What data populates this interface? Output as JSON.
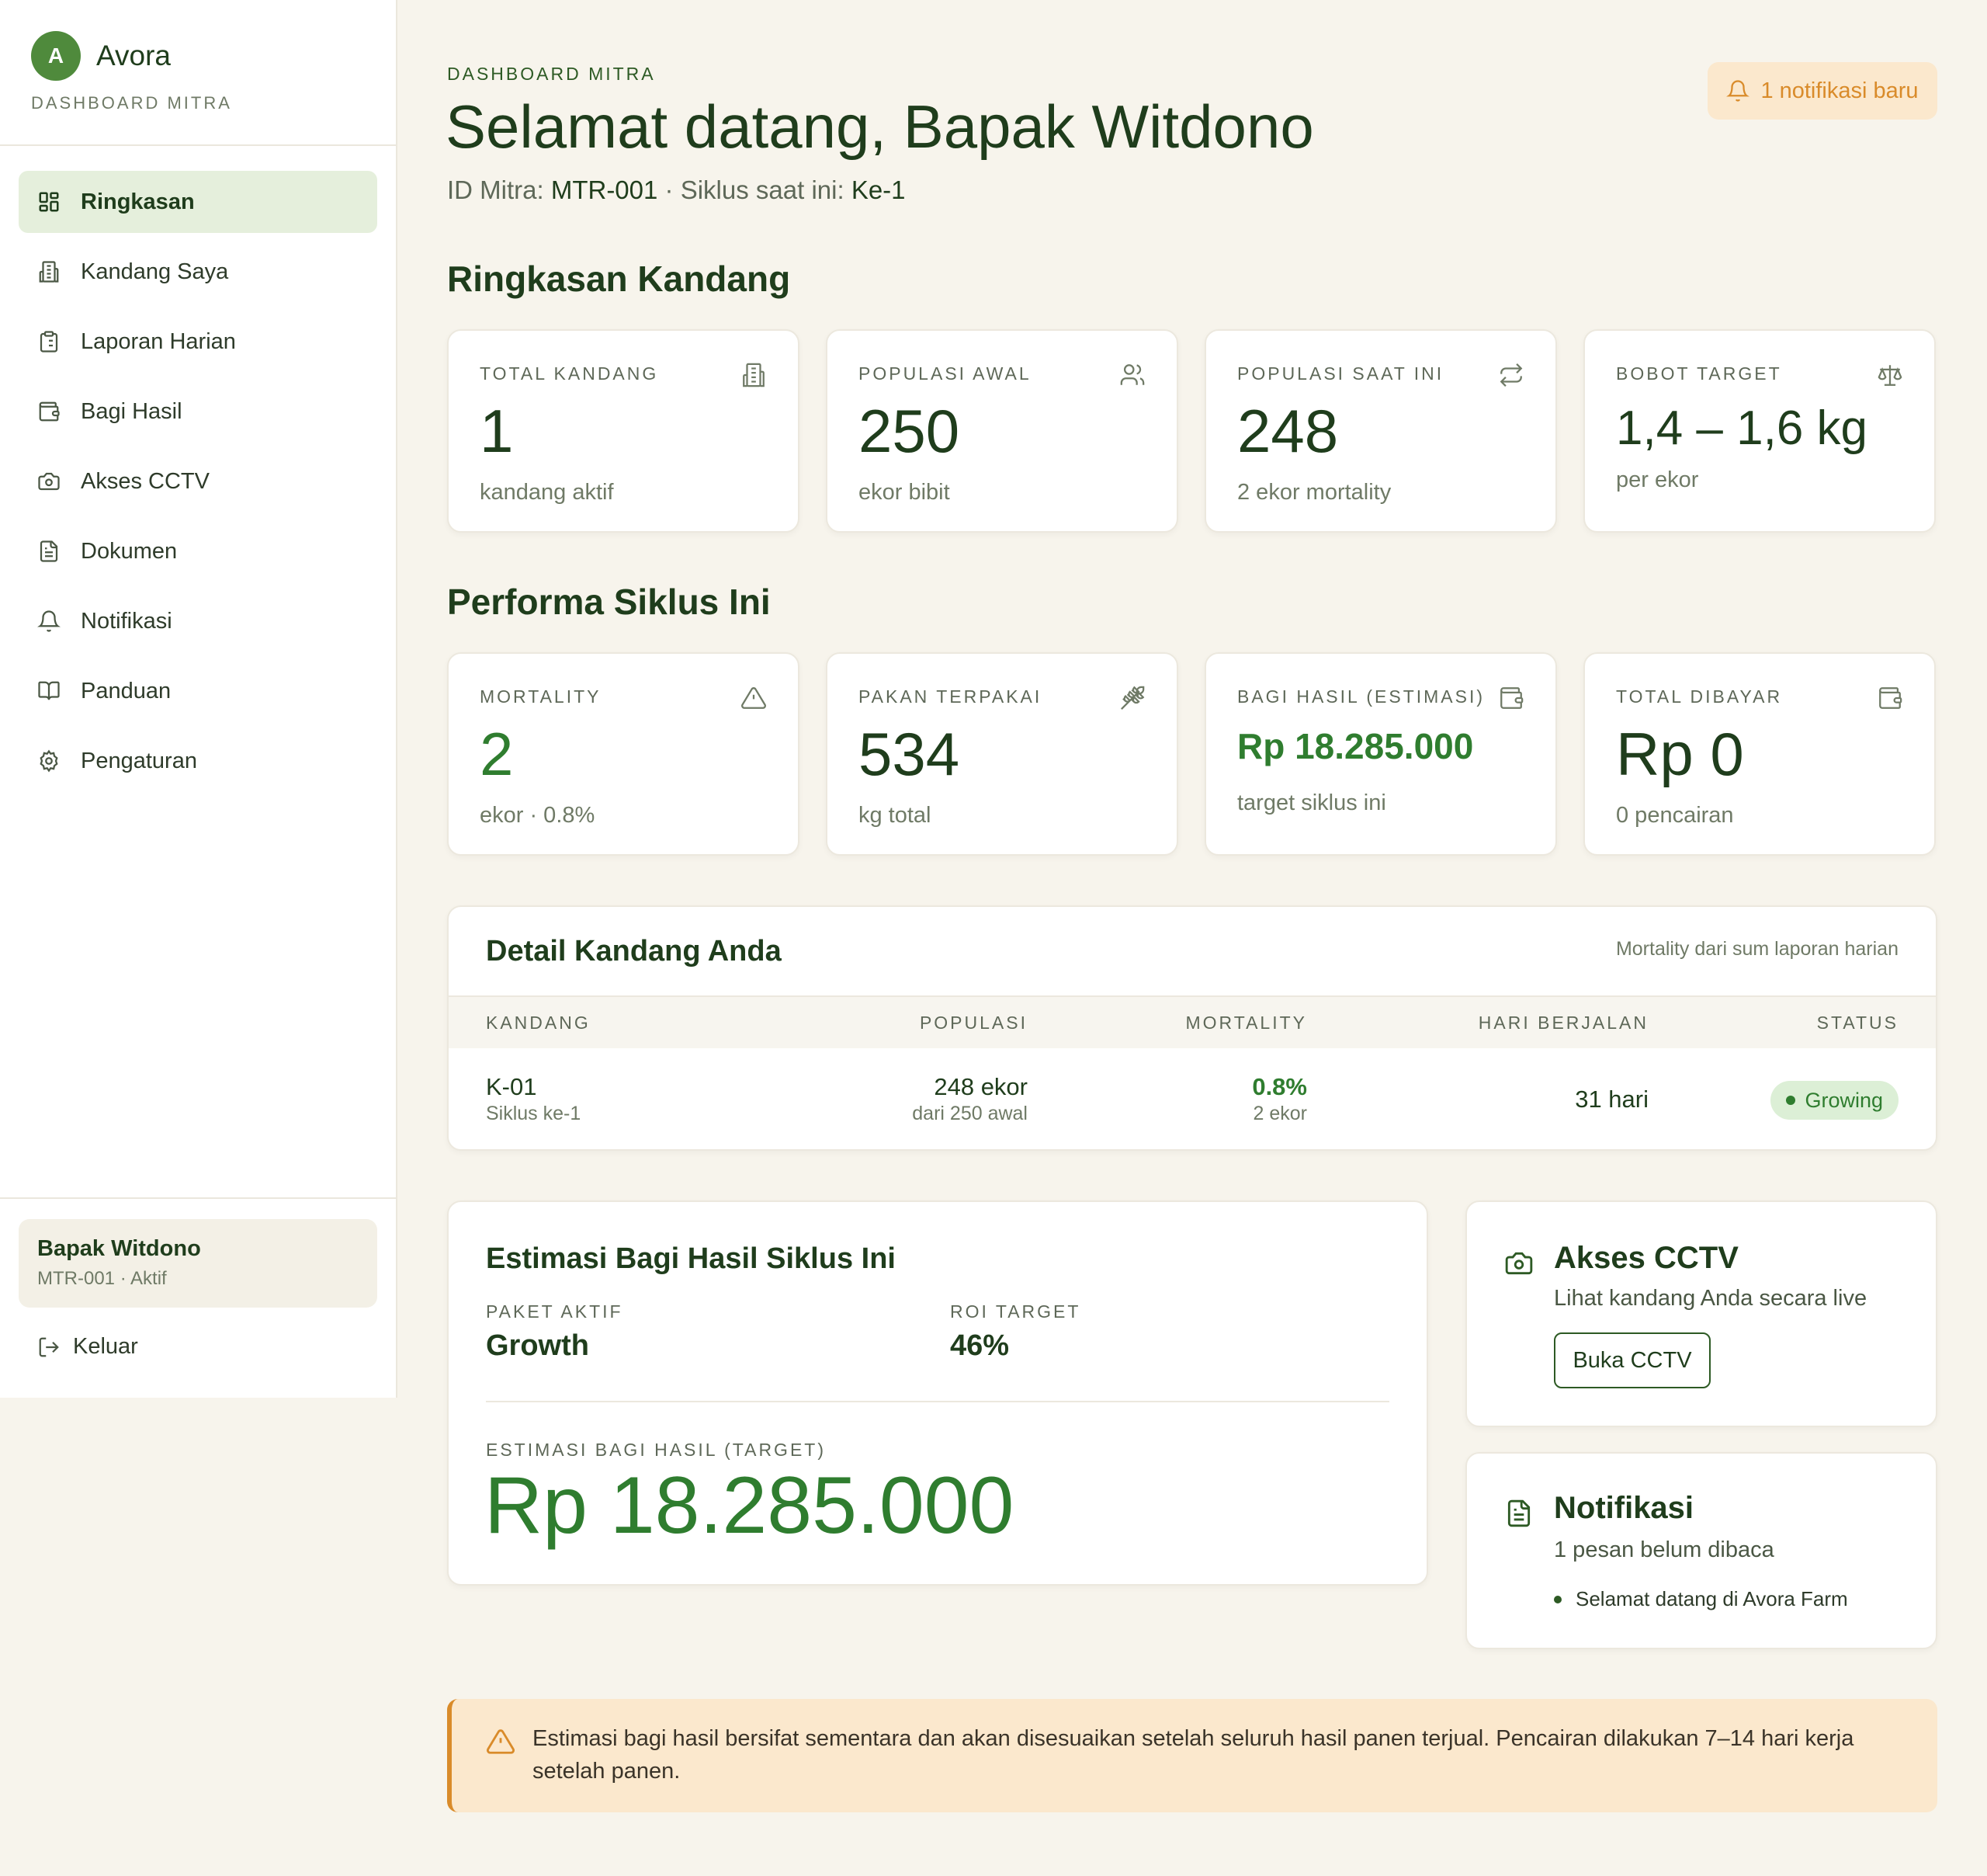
{
  "brand": {
    "logo_letter": "A",
    "name": "Avora",
    "subtitle": "DASHBOARD MITRA"
  },
  "sidebar": {
    "items": [
      {
        "label": "Ringkasan",
        "icon": "dashboard-grid-icon",
        "active": true
      },
      {
        "label": "Kandang Saya",
        "icon": "building-icon"
      },
      {
        "label": "Laporan Harian",
        "icon": "clipboard-icon"
      },
      {
        "label": "Bagi Hasil",
        "icon": "wallet-icon"
      },
      {
        "label": "Akses CCTV",
        "icon": "camera-icon"
      },
      {
        "label": "Dokumen",
        "icon": "document-icon"
      },
      {
        "label": "Notifikasi",
        "icon": "bell-icon"
      },
      {
        "label": "Panduan",
        "icon": "book-icon"
      },
      {
        "label": "Pengaturan",
        "icon": "gear-icon"
      }
    ],
    "user": {
      "name": "Bapak Witdono",
      "meta": "MTR-001 · Aktif"
    },
    "logout_label": "Keluar"
  },
  "header": {
    "eyebrow": "DASHBOARD MITRA",
    "title": "Selamat datang, Bapak Witdono",
    "id_label": "ID Mitra:",
    "id_value": "MTR-001",
    "cycle_label": "· Siklus saat ini:",
    "cycle_value": "Ke-1",
    "notification_chip": "1 notifikasi baru"
  },
  "ringkasan": {
    "title": "Ringkasan Kandang",
    "stats": [
      {
        "label": "TOTAL KANDANG",
        "value": "1",
        "sub": "kandang aktif",
        "icon": "building-icon"
      },
      {
        "label": "POPULASI AWAL",
        "value": "250",
        "sub": "ekor bibit",
        "icon": "users-icon"
      },
      {
        "label": "POPULASI SAAT INI",
        "value": "248",
        "sub": "2 ekor mortality",
        "icon": "repeat-icon"
      },
      {
        "label": "BOBOT TARGET",
        "value": "1,4 – 1,6 kg",
        "sub": "per ekor",
        "icon": "scale-icon"
      }
    ]
  },
  "performa": {
    "title": "Performa Siklus Ini",
    "stats": [
      {
        "label": "MORTALITY",
        "value": "2",
        "sub": "ekor · 0.8%",
        "icon": "warning-icon"
      },
      {
        "label": "PAKAN TERPAKAI",
        "value": "534",
        "sub": "kg total",
        "icon": "wheat-icon"
      },
      {
        "label": "BAGI HASIL (ESTIMASI)",
        "value": "Rp 18.285.000",
        "sub": "target siklus ini",
        "icon": "wallet-icon"
      },
      {
        "label": "TOTAL DIBAYAR",
        "value": "Rp 0",
        "sub": "0 pencairan",
        "icon": "wallet-icon"
      }
    ]
  },
  "detail_kandang": {
    "title": "Detail Kandang Anda",
    "note": "Mortality dari sum laporan harian",
    "columns": [
      "KANDANG",
      "POPULASI",
      "MORTALITY",
      "HARI BERJALAN",
      "STATUS"
    ],
    "rows": [
      {
        "kandang": "K-01",
        "siklus": "Siklus ke-1",
        "populasi": "248 ekor",
        "populasi_awal": "dari 250 awal",
        "mortality": "0.8%",
        "mortality_count": "2 ekor",
        "hari": "31 hari",
        "status": "Growing"
      }
    ]
  },
  "estimasi": {
    "title": "Estimasi Bagi Hasil Siklus Ini",
    "paket_label": "PAKET AKTIF",
    "paket_value": "Growth",
    "roi_label": "ROI TARGET",
    "roi_value": "46%",
    "target_label": "ESTIMASI BAGI HASIL (TARGET)",
    "target_value": "Rp 18.285.000"
  },
  "cctv": {
    "title": "Akses CCTV",
    "text": "Lihat kandang Anda secara live",
    "button": "Buka CCTV"
  },
  "notifikasi": {
    "title": "Notifikasi",
    "text": "1 pesan belum dibaca",
    "items": [
      "Selamat datang di Avora Farm"
    ]
  },
  "warning": {
    "text": "Estimasi bagi hasil bersifat sementara dan akan disesuaikan setelah seluruh hasil panen terjual. Pencairan dilakukan 7–14 hari kerja setelah panen."
  },
  "colors": {
    "primary": "#1f3d1c",
    "accent_green": "#2f7d2f",
    "logo_green": "#4f8a3c",
    "active_nav_bg": "#e5efdc",
    "page_bg": "#f7f4ec",
    "warning_bg": "#fbe8cd",
    "warning_accent": "#d98b2a"
  }
}
